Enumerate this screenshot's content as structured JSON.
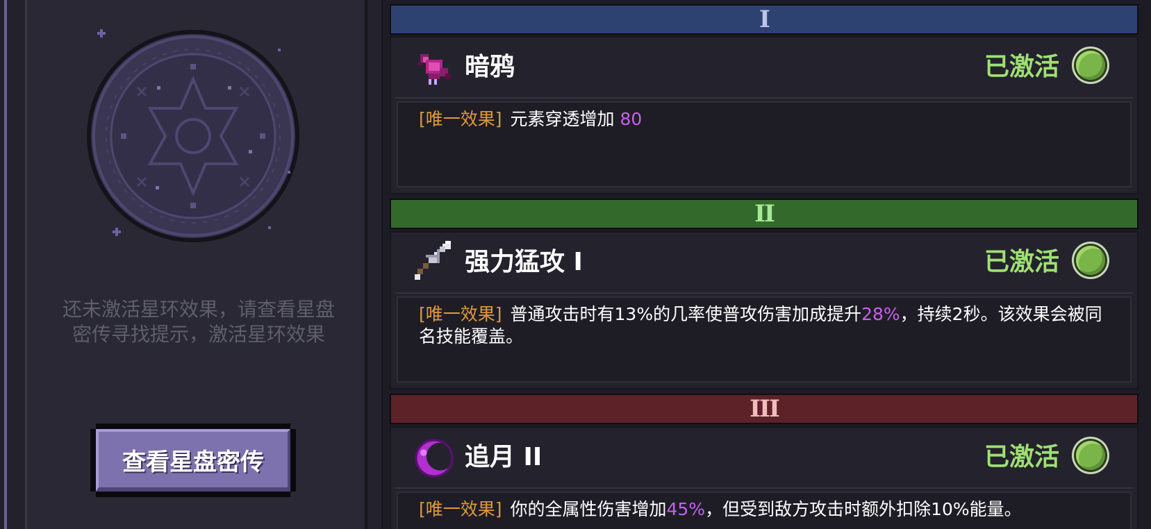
{
  "left_panel": {
    "hint": "还未激活星环效果，请查看星盘\n密传寻找提示，激活星环效果",
    "button_label": "查看星盘密传"
  },
  "tiers": [
    {
      "numeral": "I",
      "header_color": "#2e4272",
      "numeral_color": "#bcc6e8",
      "skill": {
        "icon": "crow-icon",
        "name": "暗鸦",
        "status": "已激活",
        "tag": "[唯一效果]",
        "desc_before": "元素穿透增加 ",
        "highlight": "80",
        "desc_after": ""
      }
    },
    {
      "numeral": "II",
      "header_color": "#336a2c",
      "numeral_color": "#a7e896",
      "skill": {
        "icon": "sword-icon",
        "name": "强力猛攻 I",
        "status": "已激活",
        "tag": "[唯一效果]",
        "desc_before": "普通攻击时有13%的几率使普攻伤害加成提升",
        "highlight": "28%",
        "desc_after": "，持续2秒。该效果会被同名技能覆盖。"
      }
    },
    {
      "numeral": "III",
      "header_color": "#5c2228",
      "numeral_color": "#f2bcbc",
      "skill": {
        "icon": "crescent-moon-icon",
        "name": "追月 II",
        "status": "已激活",
        "tag": "[唯一效果]",
        "desc_before": "你的全属性伤害增加",
        "highlight": "45%",
        "desc_after": "，但受到敌方攻击时额外扣除10%能量。"
      }
    }
  ]
}
